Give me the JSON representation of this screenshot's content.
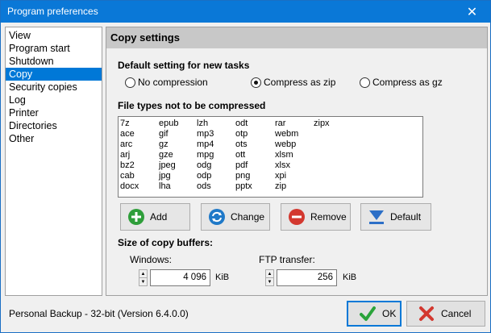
{
  "window": {
    "title": "Program preferences"
  },
  "sidebar": {
    "items": [
      {
        "label": "View"
      },
      {
        "label": "Program start"
      },
      {
        "label": "Shutdown"
      },
      {
        "label": "Copy"
      },
      {
        "label": "Security copies"
      },
      {
        "label": "Log"
      },
      {
        "label": "Printer"
      },
      {
        "label": "Directories"
      },
      {
        "label": "Other"
      }
    ],
    "selected": "Copy"
  },
  "panel": {
    "header": "Copy settings",
    "default_setting_label": "Default setting for new tasks",
    "compression": {
      "options": [
        {
          "label": "No compression",
          "checked": false
        },
        {
          "label": "Compress as zip",
          "checked": true
        },
        {
          "label": "Compress as gz",
          "checked": false
        }
      ]
    },
    "filetypes_label": "File types not to be compressed",
    "filetypes_columns": [
      [
        "7z",
        "ace",
        "arc",
        "arj",
        "bz2",
        "cab",
        "docx"
      ],
      [
        "epub",
        "gif",
        "gz",
        "gze",
        "jpeg",
        "jpg",
        "lha"
      ],
      [
        "lzh",
        "mp3",
        "mp4",
        "mpg",
        "odg",
        "odp",
        "ods"
      ],
      [
        "odt",
        "otp",
        "ots",
        "ott",
        "pdf",
        "png",
        "pptx"
      ],
      [
        "rar",
        "webm",
        "webp",
        "xlsm",
        "xlsx",
        "xpi",
        "zip"
      ],
      [
        "zipx"
      ]
    ],
    "buttons": {
      "add": "Add",
      "change": "Change",
      "remove": "Remove",
      "default": "Default"
    },
    "buffers": {
      "label": "Size of copy buffers:",
      "windows_label": "Windows:",
      "windows_value": "4 096",
      "windows_unit": "KiB",
      "ftp_label": "FTP transfer:",
      "ftp_value": "256",
      "ftp_unit": "KiB"
    }
  },
  "footer": {
    "status": "Personal Backup - 32-bit (Version 6.4.0.0)",
    "ok": "OK",
    "cancel": "Cancel"
  },
  "colors": {
    "titlebar": "#0a78d7",
    "selection": "#0078d7",
    "panel_header": "#c8c8c8",
    "add_icon": "#2e9e3a",
    "remove_icon": "#d3382f",
    "change_icon": "#1f79c8",
    "default_icon": "#2c6fc7"
  }
}
